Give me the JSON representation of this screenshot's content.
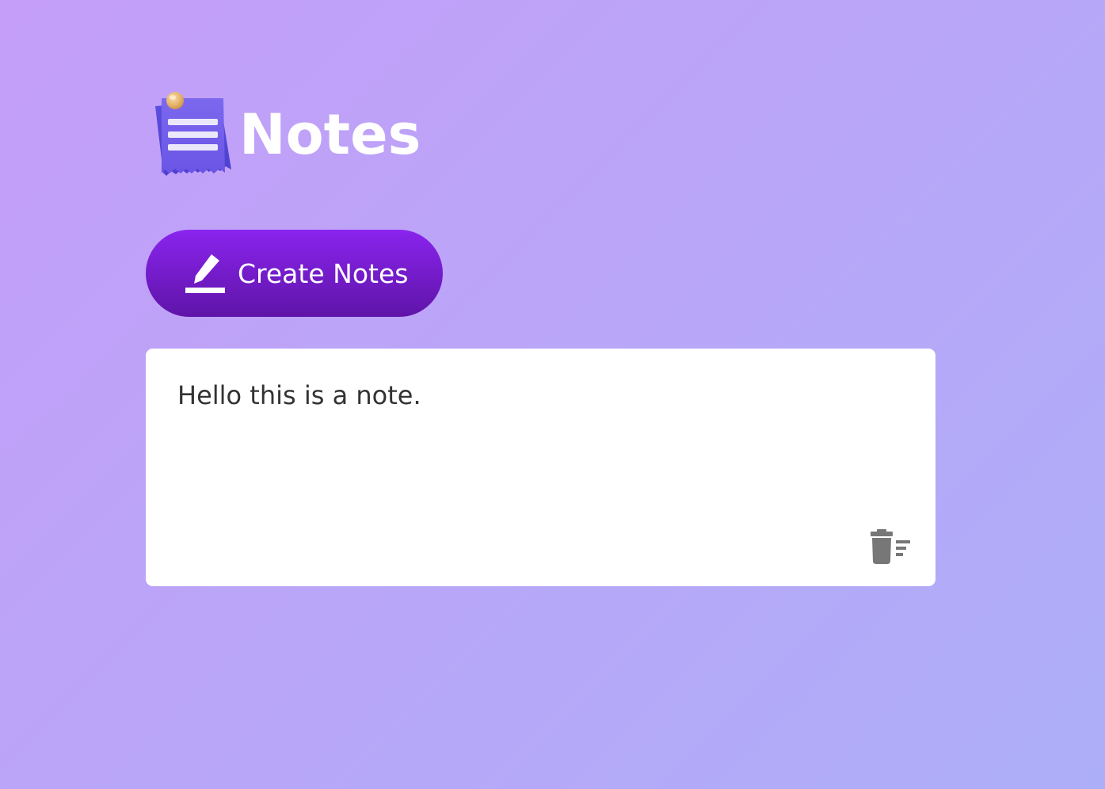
{
  "header": {
    "title": "Notes",
    "logo_icon": "notepad-pin-icon"
  },
  "toolbar": {
    "create_label": "Create Notes",
    "create_icon": "pencil-icon"
  },
  "notes": [
    {
      "text": "Hello this is a note.",
      "delete_icon": "trash-icon"
    }
  ],
  "colors": {
    "background_start": "#c49ef9",
    "background_end": "#adaef8",
    "button_top": "#8a24ee",
    "button_bottom": "#5f14a8",
    "note_background": "#ffffff",
    "note_text": "#333333",
    "icon_gray": "#777777"
  }
}
